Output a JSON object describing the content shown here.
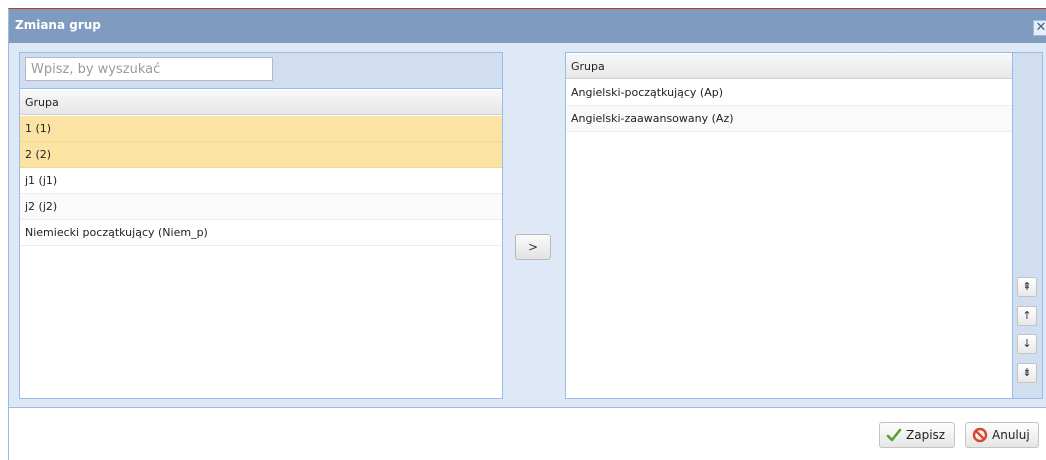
{
  "window": {
    "title": "Zmiana grup",
    "close_label": "✕"
  },
  "left": {
    "search_placeholder": "Wpisz, by wyszukać",
    "header": "Grupa",
    "rows": [
      {
        "label": "1 (1)"
      },
      {
        "label": "2 (2)"
      },
      {
        "label": "j1 (j1)"
      },
      {
        "label": "j2 (j2)"
      },
      {
        "label": "Niemiecki początkujący (Niem_p)"
      }
    ]
  },
  "move": {
    "label": ">"
  },
  "right": {
    "header": "Grupa",
    "rows": [
      {
        "label": "Angielski-początkujący (Ap)"
      },
      {
        "label": "Angielski-zaawansowany (Az)"
      }
    ],
    "order_buttons": [
      {
        "icon": "move-top-icon",
        "glyph": "⇞"
      },
      {
        "icon": "move-up-icon",
        "glyph": "↑"
      },
      {
        "icon": "move-down-icon",
        "glyph": "↓"
      },
      {
        "icon": "move-bottom-icon",
        "glyph": "⇟"
      }
    ]
  },
  "footer": {
    "save_label": "Zapisz",
    "cancel_label": "Anuluj"
  },
  "colors": {
    "title_bar": "#7f9bc0",
    "selected_row": "#fbe4a3",
    "panel_border": "#99bbe8",
    "save_check": "#5aa02c",
    "cancel_icon": "#d9482f"
  }
}
